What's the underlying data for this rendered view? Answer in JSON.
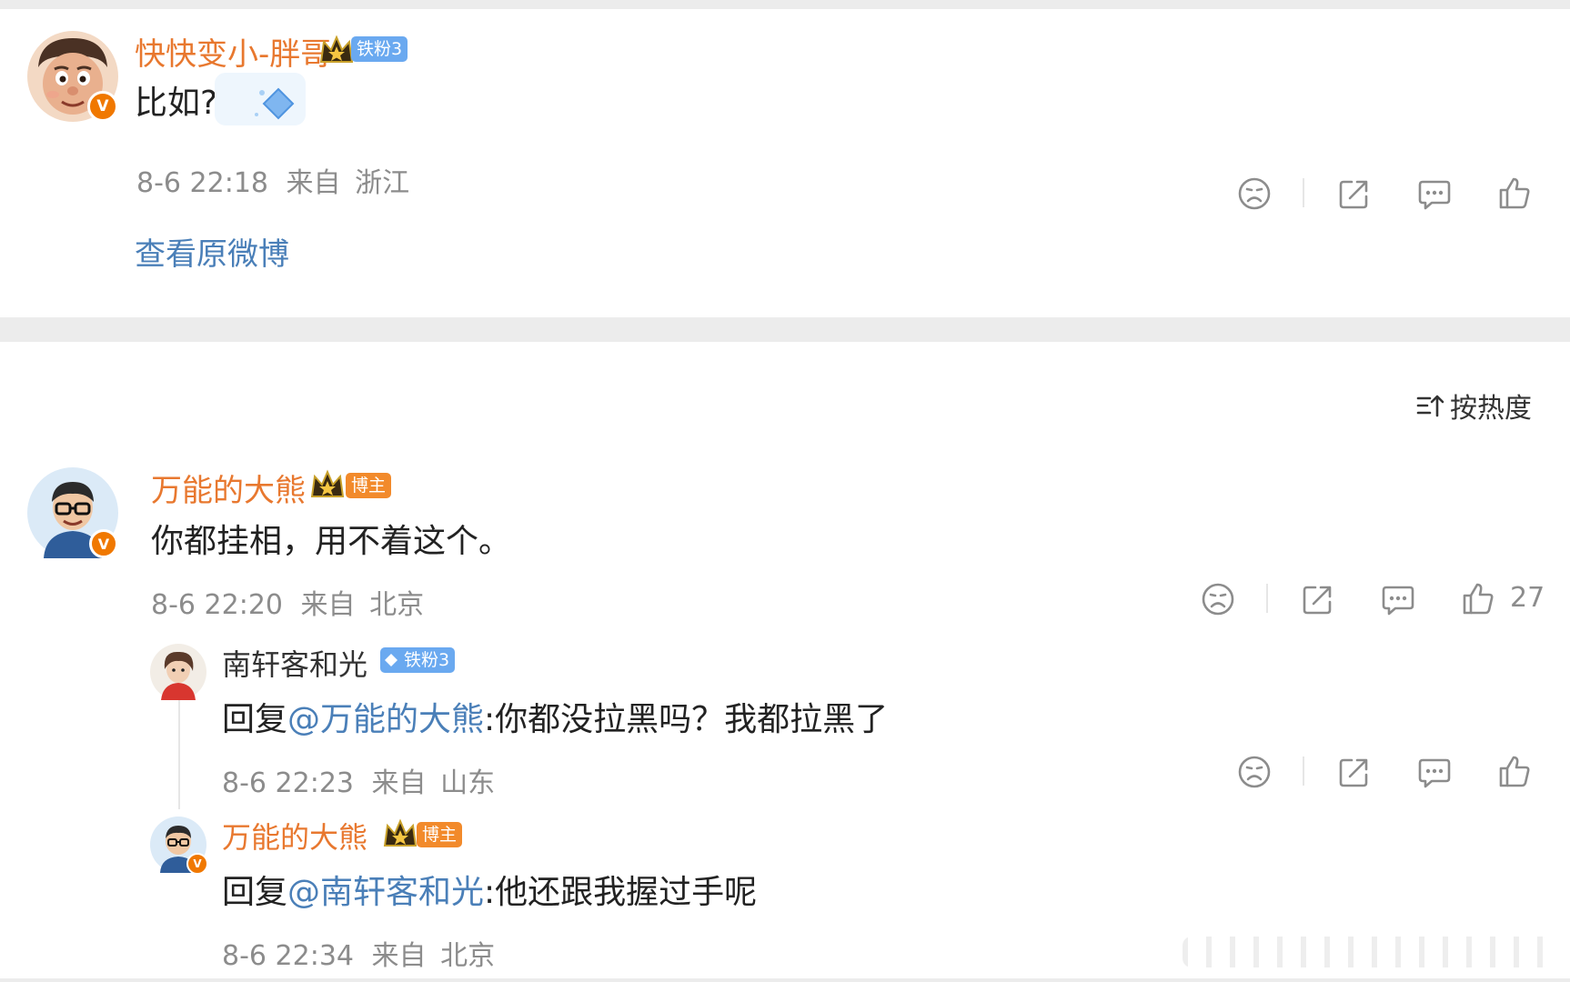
{
  "post": {
    "username": "快快变小-胖哥",
    "fan_badge": "铁粉3",
    "text": "比如?",
    "time": "8-6 22:18",
    "from_label": "来自",
    "location": "浙江",
    "view_original": "查看原微博"
  },
  "sort": {
    "label": "按热度",
    "icon": "sort-icon"
  },
  "comments": [
    {
      "username": "万能的大熊",
      "badge": "博主",
      "text": "你都挂相，用不着这个。",
      "time": "8-6 22:20",
      "from_label": "来自",
      "location": "北京",
      "like_count": "27"
    }
  ],
  "replies": [
    {
      "username": "南轩客和光",
      "badge": "铁粉3",
      "reply_prefix": "回复",
      "mention": "@万能的大熊",
      "text": ":你都没拉黑吗？我都拉黑了",
      "time": "8-6 22:23",
      "from_label": "来自",
      "location": "山东"
    },
    {
      "username": "万能的大熊",
      "badge": "博主",
      "reply_prefix": "回复",
      "mention": "@南轩客和光",
      "text": ":他还跟我握过手呢",
      "time": "8-6 22:34",
      "from_label": "来自",
      "location": "北京"
    }
  ],
  "colors": {
    "username_orange": "#e8782f",
    "mention_blue": "#4a7fb8",
    "meta_gray": "#8c8c8c",
    "verified_badge": "#f07800",
    "fan_tag_blue": "#6aa9f0",
    "host_tag_orange": "#f28a2b"
  },
  "verified_symbol": "V"
}
